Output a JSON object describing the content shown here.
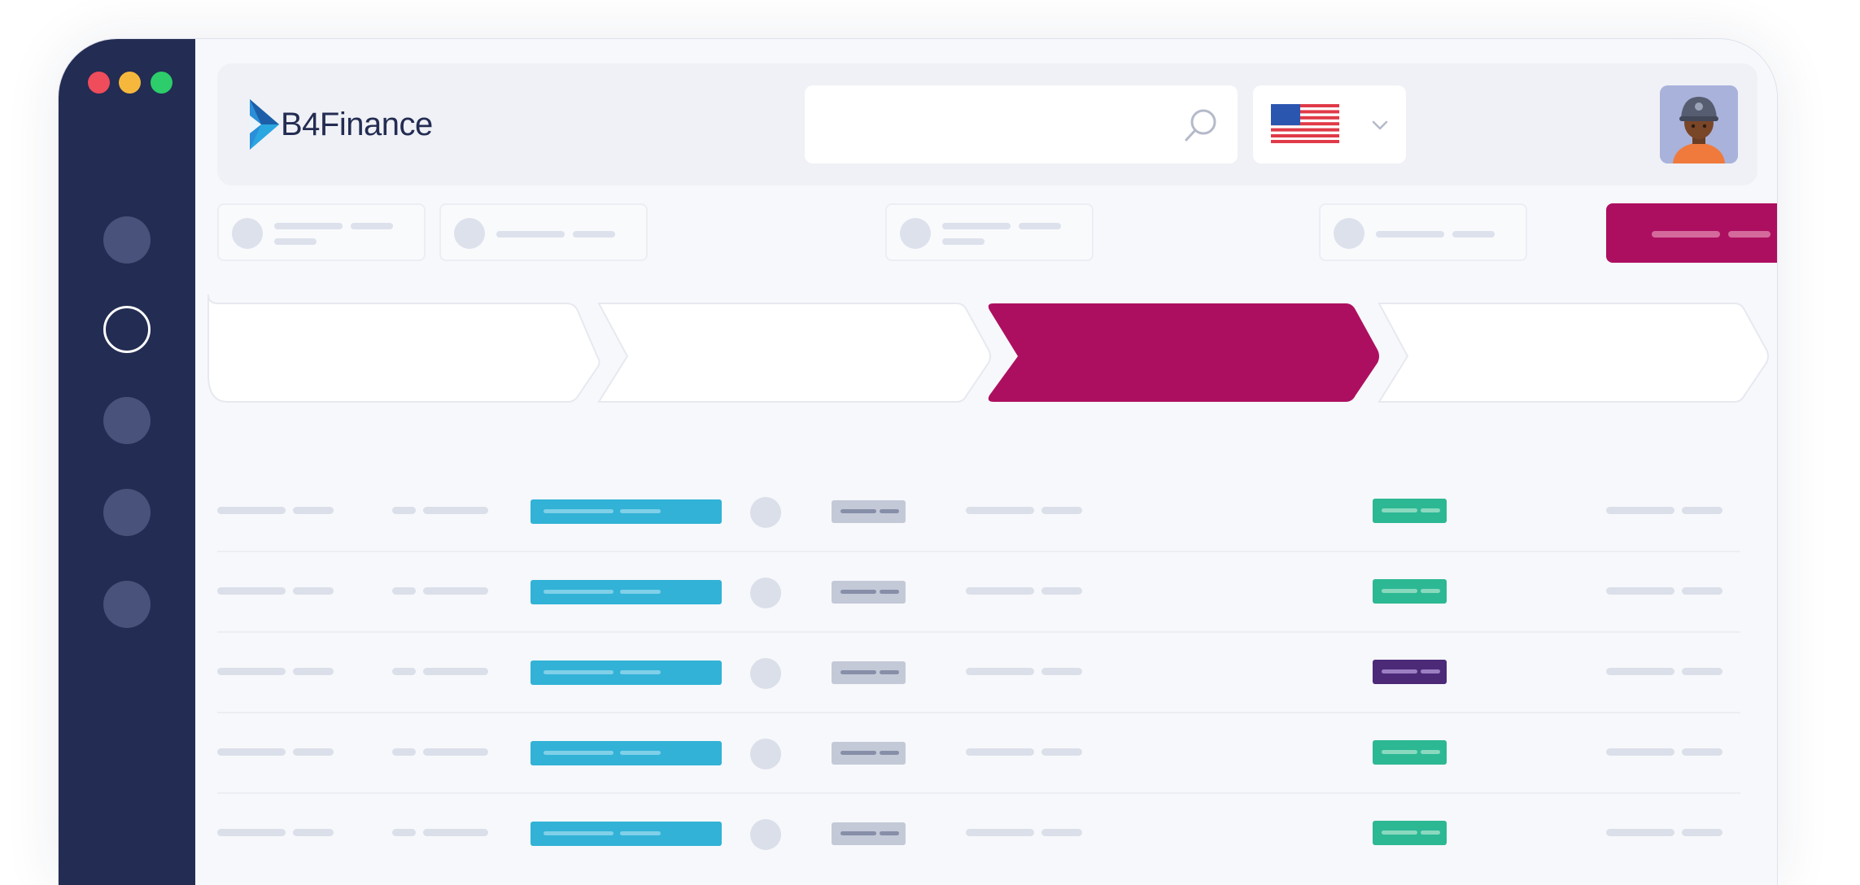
{
  "app": {
    "logo_text": "B4Finance",
    "logo_icon": "play-arrow-logo-icon",
    "colors": {
      "sidebar": "#232c52",
      "accent": "#ad0f60",
      "cyan_tag": "#32b2d6",
      "green_badge": "#2db894",
      "purple_badge": "#4c2a78",
      "gray_tag": "#c3c9d7"
    }
  },
  "window_controls": [
    "close-dot",
    "minimize-dot",
    "maximize-dot"
  ],
  "header": {
    "search": {
      "placeholder": "",
      "icon": "search-icon"
    },
    "language": {
      "selected": "en-US",
      "icon": "us-flag-icon",
      "dropdown_icon": "chevron-down-icon"
    },
    "avatar": {
      "icon": "user-avatar-icon"
    }
  },
  "sidebar": {
    "items": [
      {
        "id": "nav-1",
        "active": false
      },
      {
        "id": "nav-2",
        "active": true
      },
      {
        "id": "nav-3",
        "active": false
      },
      {
        "id": "nav-4",
        "active": false
      },
      {
        "id": "nav-5",
        "active": false
      }
    ]
  },
  "steps": {
    "count": 4,
    "active_index": 2
  },
  "table": {
    "row_count": 5,
    "status_badges": [
      "green",
      "green",
      "purple",
      "green",
      "green"
    ]
  }
}
